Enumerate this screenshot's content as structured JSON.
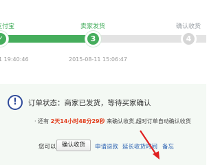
{
  "steps": [
    {
      "label": "支付宝",
      "time": "1 19:40:46"
    },
    {
      "label": "卖家发货",
      "number": "3",
      "time": "2015-08-11 15:06:47"
    },
    {
      "label": "确认收货",
      "number": "4"
    }
  ],
  "status": {
    "icon": "info-icon",
    "text": "订单状态：商家已发货，等待买家确认"
  },
  "countdown": {
    "prefix": "· 还有",
    "time": "2天14小时48分29秒",
    "suffix": "来确认收货,超时订单自动确认收货"
  },
  "actions": {
    "hint": "您可以",
    "confirm": "确认收货",
    "refund": "申请退款",
    "extend": "延长收货时间",
    "note": "备忘"
  },
  "colors": {
    "accent": "#45ad5c",
    "countdown": "#e23c1b",
    "link": "#2d64b3",
    "arrow": "#e02020"
  }
}
